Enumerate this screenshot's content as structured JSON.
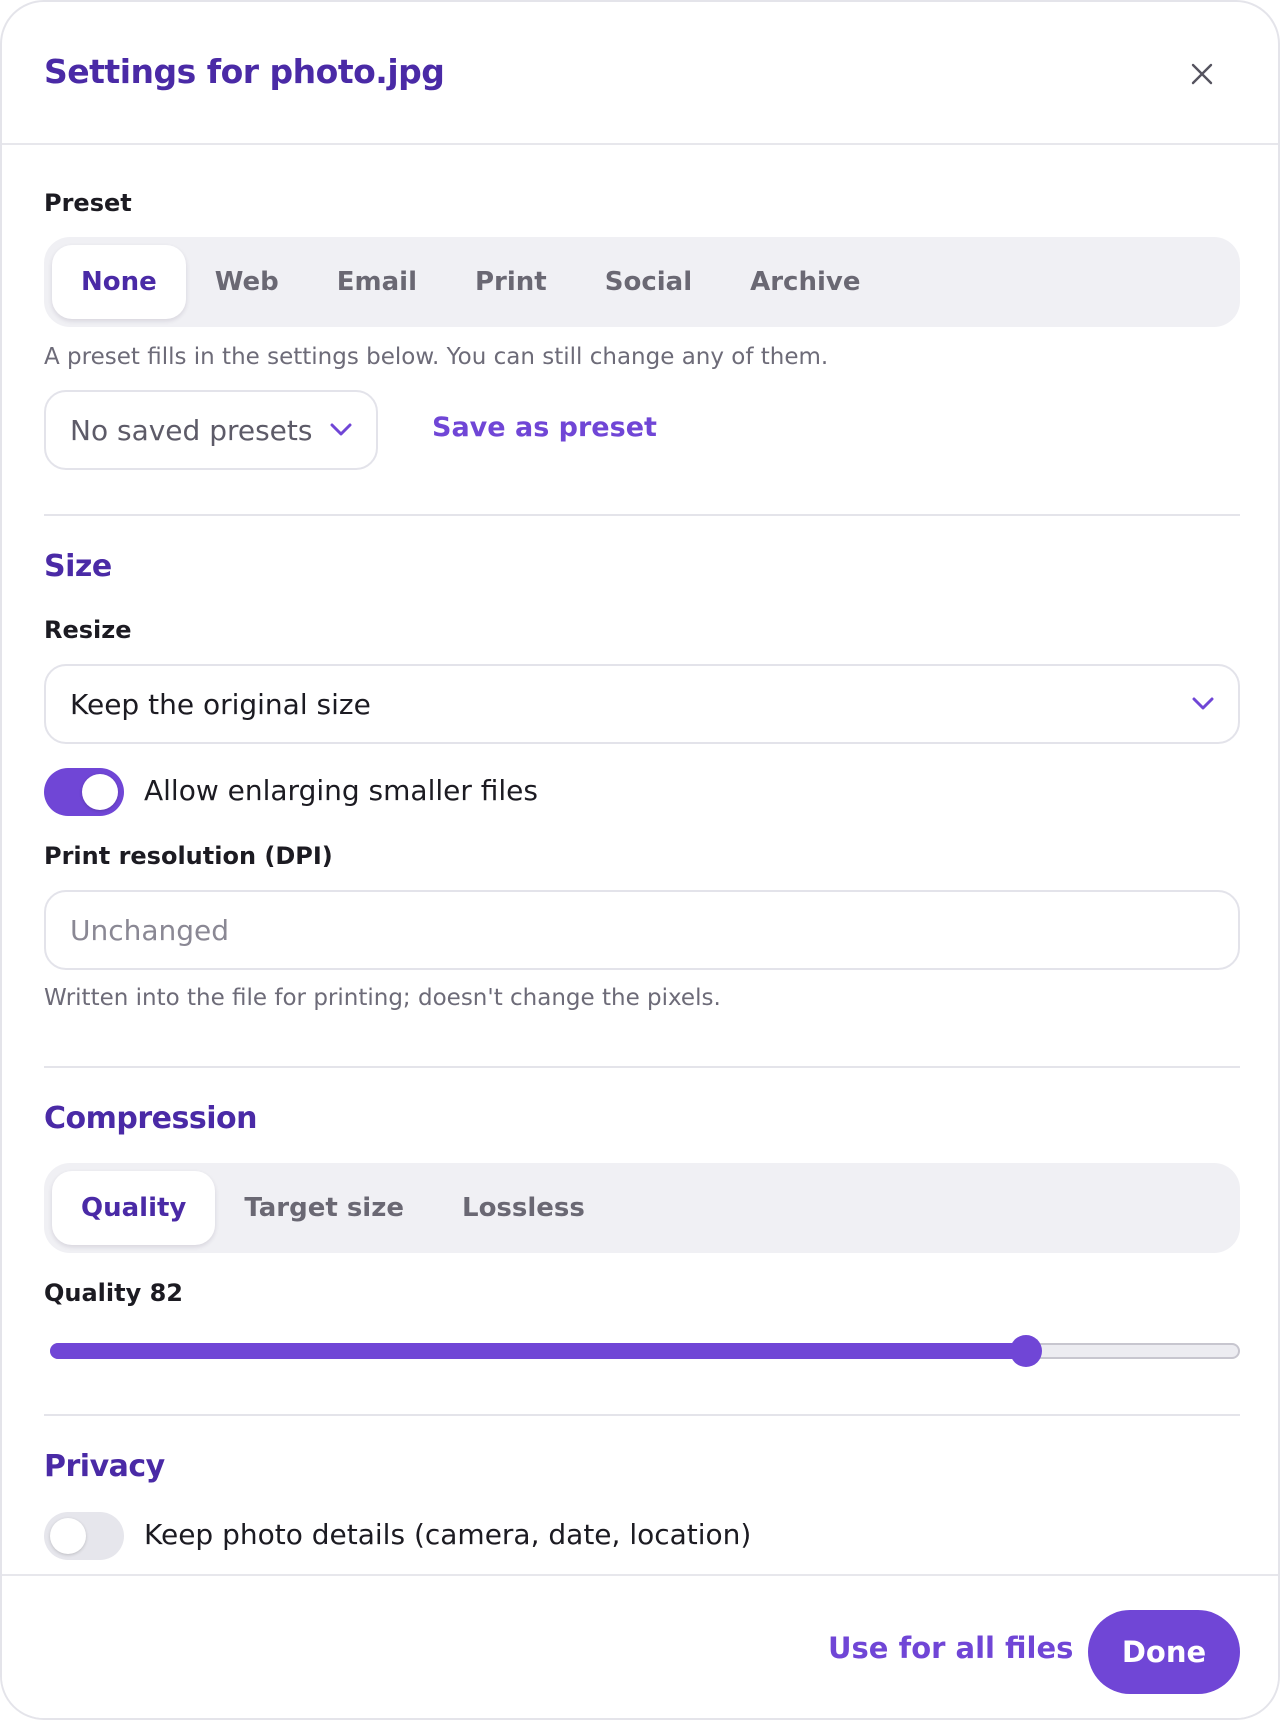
{
  "dialog": {
    "title": "Settings for photo.jpg",
    "close_icon": "close-icon"
  },
  "preset": {
    "label": "Preset",
    "options": [
      "None",
      "Web",
      "Email",
      "Print",
      "Social",
      "Archive"
    ],
    "selected": "None",
    "hint": "A preset fills in the settings below. You can still change any of them.",
    "saved_presets_value": "No saved presets",
    "save_label": "Save as preset"
  },
  "size": {
    "heading": "Size",
    "resize_label": "Resize",
    "resize_value": "Keep the original size",
    "enlarge_label": "Allow enlarging smaller files",
    "enlarge_on": true,
    "dpi_label": "Print resolution (DPI)",
    "dpi_value": "",
    "dpi_placeholder": "Unchanged",
    "dpi_hint": "Written into the file for printing; doesn't change the pixels."
  },
  "compression": {
    "heading": "Compression",
    "modes": [
      "Quality",
      "Target size",
      "Lossless"
    ],
    "selected": "Quality",
    "quality_label": "Quality 82",
    "quality_value": 82,
    "quality_min": 0,
    "quality_max": 100
  },
  "privacy": {
    "heading": "Privacy",
    "keep_details_label": "Keep photo details (camera, date, location)",
    "keep_details_on": false
  },
  "footer": {
    "apply_all_label": "Use for all files",
    "done_label": "Done"
  },
  "colors": {
    "accent": "#7046d6",
    "heading": "#4a2aa6",
    "surface": "#f0f0f4"
  }
}
